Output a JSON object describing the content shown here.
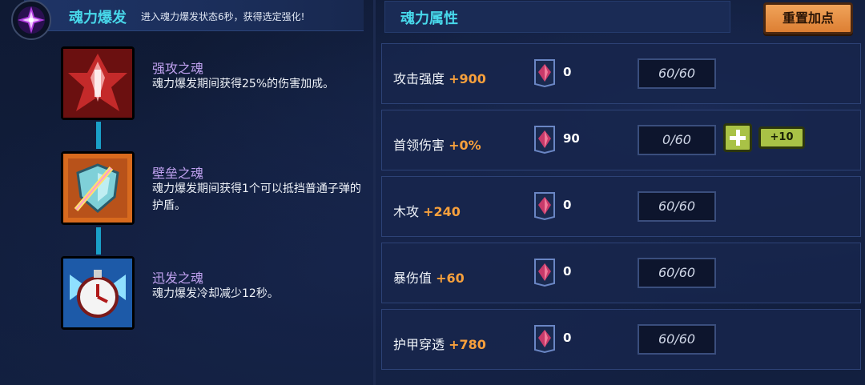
{
  "burst": {
    "title": "魂力爆发",
    "description": "进入魂力爆发状态6秒，获得选定强化!"
  },
  "skills": [
    {
      "name": "强攻之魂",
      "description": "魂力爆发期间获得25%的伤害加成。",
      "icon": "red-crystal-icon"
    },
    {
      "name": "壁垒之魂",
      "description": "魂力爆发期间获得1个可以抵挡普通子弹的护盾。",
      "icon": "shield-icon"
    },
    {
      "name": "迅发之魂",
      "description": "魂力爆发冷却减少12秒。",
      "icon": "clock-icon"
    }
  ],
  "attributes_panel": {
    "title": "魂力属性",
    "reset_label": "重置加点"
  },
  "attributes": [
    {
      "name": "攻击强度",
      "bonus": "+900",
      "gems": "0",
      "level": "60/60"
    },
    {
      "name": "首领伤害",
      "bonus": "+0%",
      "gems": "90",
      "level": "0/60",
      "plus_label": "+10"
    },
    {
      "name": "木攻",
      "bonus": "+240",
      "gems": "0",
      "level": "60/60"
    },
    {
      "name": "暴伤值",
      "bonus": "+60",
      "gems": "0",
      "level": "60/60"
    },
    {
      "name": "护甲穿透",
      "bonus": "+780",
      "gems": "0",
      "level": "60/60"
    }
  ],
  "colors": {
    "accent_cyan": "#48d8ea",
    "bonus_orange": "#f7a03c",
    "skill_name_purple": "#c0a2f0",
    "button_green": "#a9c246",
    "button_orange": "#dd7f33"
  }
}
